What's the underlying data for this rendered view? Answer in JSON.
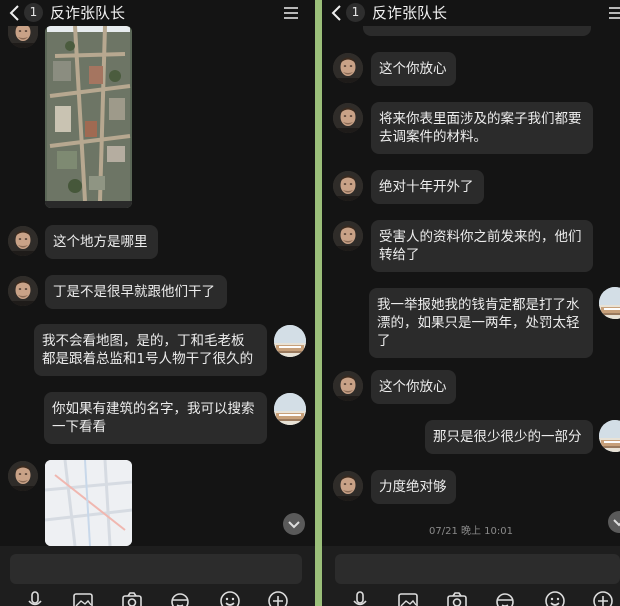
{
  "chat_title": "反诈张队长",
  "unread_count": "1",
  "left": {
    "messages": [
      {
        "text": "这个地方是哪里"
      },
      {
        "text": "丁是不是很早就跟他们干了"
      },
      {
        "text": "我不会看地图，是的，丁和毛老板\n都是跟着总监和1号人物干了很久的"
      },
      {
        "text": "你如果有建筑的名字，我可以搜索\n一下看看"
      }
    ]
  },
  "right": {
    "messages": [
      {
        "text": "这个你放心"
      },
      {
        "text": "将来你表里面涉及的案子我们都要\n去调案件的材料。"
      },
      {
        "text": "绝对十年开外了"
      },
      {
        "text": "受害人的资料你之前发来的，他们\n转给了"
      },
      {
        "text": "我一举报她我的钱肯定都是打了水\n漂的，如果只是一两年，处罚太轻\n了"
      },
      {
        "text": "这个你放心"
      },
      {
        "text": "那只是很少很少的一部分"
      },
      {
        "text": "力度绝对够"
      }
    ],
    "timestamp": "07/21 晚上 10:01"
  },
  "icons": [
    "chevron-left-icon",
    "menu-icon",
    "microphone-icon",
    "image-icon",
    "camera-icon",
    "sticker-icon",
    "emoji-icon",
    "plus-icon",
    "chevron-down-icon"
  ],
  "colors": {
    "background": "#141414",
    "bubble": "#2b2b2b",
    "text": "#ededed",
    "divider": "#9bbf7a"
  }
}
